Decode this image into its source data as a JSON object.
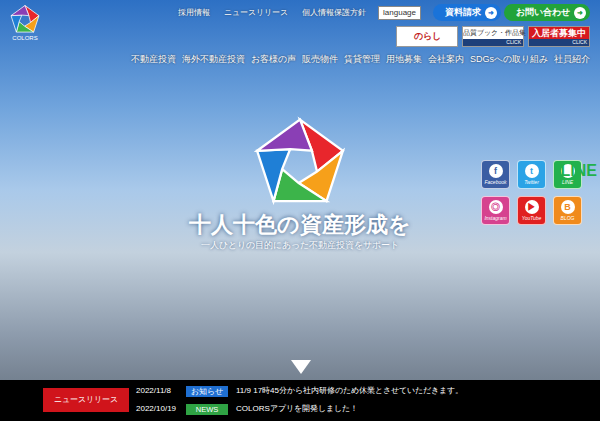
{
  "logo": {
    "text": "COLORS"
  },
  "top_links": [
    "採用情報",
    "ニュースリリース",
    "個人情報保護方針"
  ],
  "language": "language",
  "cta_buttons": [
    {
      "label": "資料請求",
      "arrow": "➜",
      "color": "#1a73d9"
    },
    {
      "label": "お問い合わせ",
      "arrow": "➜",
      "color": "#22a33a"
    }
  ],
  "banners": [
    {
      "kind": "logo",
      "label": "のらし",
      "sub": ""
    },
    {
      "kind": "book",
      "label": "品質ブック・作品集",
      "sub": "CLICK"
    },
    {
      "kind": "recruit",
      "label": "入居者募集中",
      "sub": "CLICK"
    }
  ],
  "nav": [
    "不動産投資",
    "海外不動産投資",
    "お客様の声",
    "販売物件",
    "賃貸管理",
    "用地募集",
    "会社案内",
    "SDGsへの取り組み",
    "社員紹介"
  ],
  "hero": {
    "title": "十人十色の資産形成を",
    "subtitle": "一人ひとりの目的にあった不動産投資をサポート"
  },
  "social": [
    {
      "label": "Facebook",
      "glyph": "f",
      "color": "#3b5da3"
    },
    {
      "label": "Twitter",
      "glyph": "t",
      "color": "#2ba3e6"
    },
    {
      "label": "LINE",
      "glyph": "LINE",
      "color": "#22b14c"
    },
    {
      "label": "Instagram",
      "glyph": "◎",
      "color": "#d6428f"
    },
    {
      "label": "YouTube",
      "glyph": "▶",
      "color": "#e02020"
    },
    {
      "label": "BLOG",
      "glyph": "B",
      "color": "#f08a1c"
    }
  ],
  "news": {
    "button": "ニュースリリース",
    "items": [
      {
        "date": "2022/11/8",
        "tag": "お知らせ",
        "color": "#1f6fd1",
        "text": "11/9 17時45分から社内研修のため休業とさせていただきます。"
      },
      {
        "date": "2022/10/19",
        "tag": "NEWS",
        "color": "#2fa344",
        "text": "COLORSアプリを開発しました！"
      }
    ]
  }
}
